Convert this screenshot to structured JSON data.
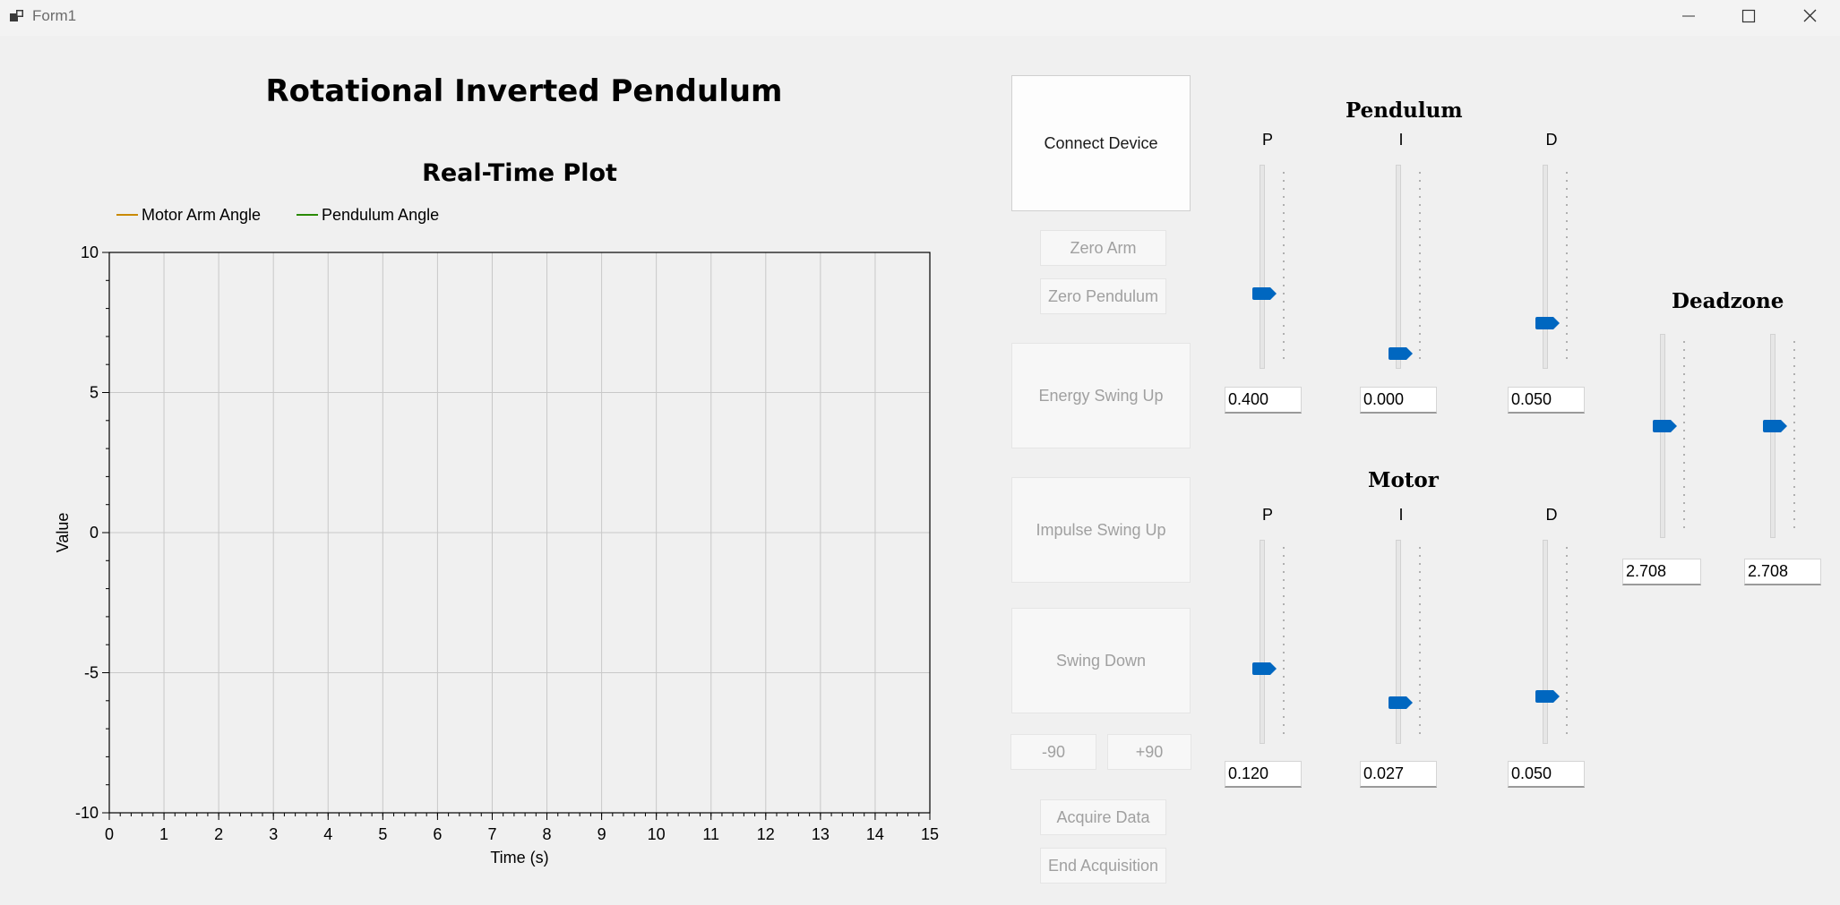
{
  "window": {
    "title": "Form1",
    "icon": "app-icon",
    "controls": [
      "minimize-icon",
      "maximize-icon",
      "close-icon"
    ]
  },
  "header": {
    "title": "Rotational Inverted Pendulum"
  },
  "chart": {
    "title": "Real-Time Plot",
    "legend": [
      {
        "label": "Motor Arm Angle",
        "color": "#c98a00"
      },
      {
        "label": "Pendulum Angle",
        "color": "#2a8a00"
      }
    ]
  },
  "chart_data": {
    "type": "line",
    "title": "Real-Time Plot",
    "xlabel": "Time (s)",
    "ylabel": "Value",
    "xlim": [
      0,
      15
    ],
    "ylim": [
      -10,
      10
    ],
    "x_ticks": [
      "0",
      "1",
      "2",
      "3",
      "4",
      "5",
      "6",
      "7",
      "8",
      "9",
      "10",
      "11",
      "12",
      "13",
      "14",
      "15"
    ],
    "y_ticks": [
      "10",
      "5",
      "0",
      "-5",
      "-10"
    ],
    "grid": true,
    "legend_position": "top-left",
    "series": [
      {
        "name": "Motor Arm Angle",
        "color": "#c98a00",
        "x": [],
        "y": []
      },
      {
        "name": "Pendulum Angle",
        "color": "#2a8a00",
        "x": [],
        "y": []
      }
    ]
  },
  "buttons": {
    "connect": "Connect Device",
    "zero_arm": "Zero Arm",
    "zero_pendulum": "Zero Pendulum",
    "energy_swing_up": "Energy Swing Up",
    "impulse_swing_up": "Impulse Swing Up",
    "swing_down": "Swing Down",
    "minus90": "-90",
    "plus90": "+90",
    "acquire": "Acquire Data",
    "end_acquisition": "End Acquisition"
  },
  "pendulum": {
    "title": "Pendulum",
    "p": {
      "label": "P",
      "value": "0.400",
      "level": 0.36
    },
    "i": {
      "label": "I",
      "value": "0.000",
      "level": 0.04
    },
    "d": {
      "label": "D",
      "value": "0.050",
      "level": 0.2
    }
  },
  "motor": {
    "title": "Motor",
    "p": {
      "label": "P",
      "value": "0.120",
      "level": 0.36
    },
    "i": {
      "label": "I",
      "value": "0.027",
      "level": 0.18
    },
    "d": {
      "label": "D",
      "value": "0.050",
      "level": 0.21
    }
  },
  "deadzone": {
    "title": "Deadzone",
    "left": {
      "value": "2.708",
      "level": 0.56
    },
    "right": {
      "value": "2.708",
      "level": 0.56
    }
  },
  "colors": {
    "accent": "#0067c0",
    "background": "#f0f0f0"
  }
}
